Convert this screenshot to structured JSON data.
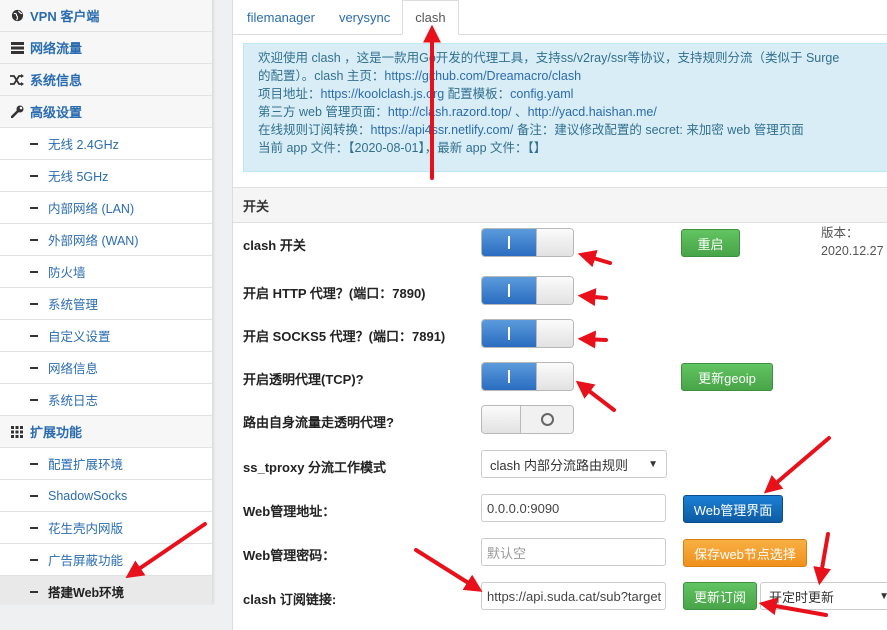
{
  "sidebar": {
    "items": [
      {
        "label": "VPN 客户端",
        "kind": "top",
        "icon": "globe-icon"
      },
      {
        "label": "网络流量",
        "kind": "top",
        "icon": "list-icon"
      },
      {
        "label": "系统信息",
        "kind": "top",
        "icon": "shuffle-icon"
      },
      {
        "label": "高级设置",
        "kind": "top",
        "icon": "wrench-icon"
      },
      {
        "label": "无线 2.4GHz",
        "kind": "sub"
      },
      {
        "label": "无线 5GHz",
        "kind": "sub"
      },
      {
        "label": "内部网络 (LAN)",
        "kind": "sub"
      },
      {
        "label": "外部网络 (WAN)",
        "kind": "sub"
      },
      {
        "label": "防火墙",
        "kind": "sub"
      },
      {
        "label": "系统管理",
        "kind": "sub"
      },
      {
        "label": "自定义设置",
        "kind": "sub"
      },
      {
        "label": "网络信息",
        "kind": "sub"
      },
      {
        "label": "系统日志",
        "kind": "sub"
      },
      {
        "label": "扩展功能",
        "kind": "top",
        "icon": "grid-icon"
      },
      {
        "label": "配置扩展环境",
        "kind": "sub"
      },
      {
        "label": "ShadowSocks",
        "kind": "sub"
      },
      {
        "label": "花生壳内网版",
        "kind": "sub"
      },
      {
        "label": "广告屏蔽功能",
        "kind": "sub"
      },
      {
        "label": "搭建Web环境",
        "kind": "sub",
        "active": true
      }
    ]
  },
  "tabs": [
    {
      "label": "filemanager",
      "active": false
    },
    {
      "label": "verysync",
      "active": false
    },
    {
      "label": "clash",
      "active": true
    }
  ],
  "info": {
    "line1": "欢迎使用 clash ，这是一款用Go开发的代理工具，支持ss/v2ray/ssr等协议，支持规则分流（类似于 Surge",
    "line2_text": "的配置）。clash 主页：",
    "line2_link": "https://github.com/Dreamacro/clash",
    "line3_text": "项目地址：",
    "line3_link": "https://koolclash.js.org",
    "line3_text2": " 配置模板：",
    "line3_link2": "config.yaml",
    "line4_text": "第三方 web 管理页面：",
    "line4_link": "http://clash.razord.top/",
    "line4_sep": " 、",
    "line4_link2": "http://yacd.haishan.me/",
    "line5_text": "在线规则订阅转换：",
    "line5_link": "https://api4ssr.netlify.com/",
    "line5_text2": " 备注：建议修改配置的 secret: 来加密 web 管理页面",
    "line6": "当前 app 文件：【2020-08-01】，最新 app 文件：【】"
  },
  "section_title": "开关",
  "version": {
    "label": "版本：",
    "value": "2020.12.27"
  },
  "rows": {
    "clash_switch": {
      "label": "clash 开关",
      "on": true,
      "button": "重启"
    },
    "http_proxy": {
      "label": "开启 HTTP 代理？(端口：7890)",
      "on": true
    },
    "socks5_proxy": {
      "label": "开启 SOCKS5 代理？(端口：7891)",
      "on": true
    },
    "tproxy": {
      "label": "开启透明代理(TCP)?",
      "on": true,
      "button": "更新geoip"
    },
    "self_traffic": {
      "label": "路由自身流量走透明代理?",
      "on": false
    },
    "ss_tproxy_mode": {
      "label": "ss_tproxy 分流工作模式",
      "selected": "clash 内部分流路由规则"
    },
    "web_addr": {
      "label": "Web管理地址：",
      "value": "0.0.0.0:9090",
      "button": "Web管理界面"
    },
    "web_pass": {
      "label": "Web管理密码：",
      "placeholder": "默认空",
      "button": "保存web节点选择"
    },
    "sub_link": {
      "label": "clash 订阅链接:",
      "value": "https://api.suda.cat/sub?target",
      "button": "更新订阅",
      "schedule": "开定时更新"
    }
  },
  "colors": {
    "accent": "#2a6cb0",
    "arrow": "#e8111b",
    "green": "#48a448",
    "blue": "#0d5ba3",
    "orange": "#f0901c"
  }
}
